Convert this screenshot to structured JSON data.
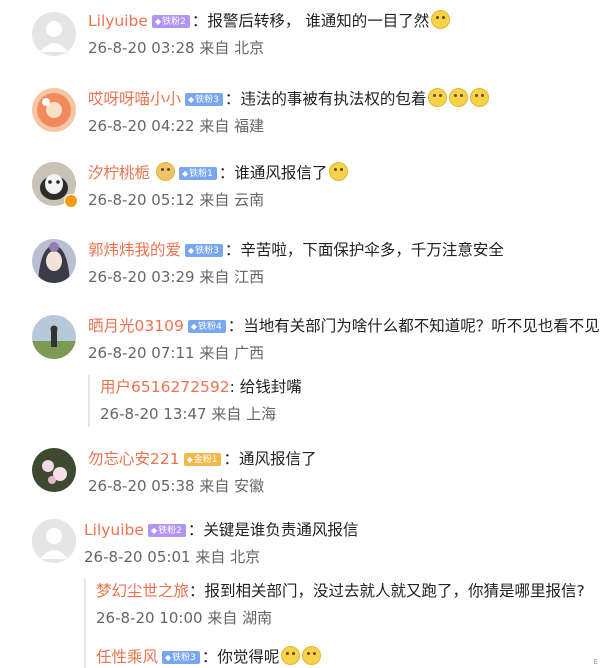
{
  "comments": [
    {
      "username": "Lilyuibe",
      "badge": "铁粉2",
      "badge_color": "purple",
      "text": "：报警后转移，  谁通知的一目了然",
      "emoji_count": 1,
      "date": "26-8-20 03:28",
      "from_label": "来自",
      "location": "北京"
    },
    {
      "username": "哎呀呀喵小小",
      "badge": "铁粉3",
      "badge_color": "blue",
      "text": "：违法的事被有执法权的包着",
      "emoji_count": 3,
      "date": "26-8-20 04:22",
      "from_label": "来自",
      "location": "福建"
    },
    {
      "username": "汐柠桃栀",
      "badge": "铁粉1",
      "badge_color": "blue",
      "text": "：谁通风报信了",
      "emoji_count": 1,
      "date": "26-8-20 05:12",
      "from_label": "来自",
      "location": "云南"
    },
    {
      "username": "郭炜炜我的爱",
      "badge": "铁粉3",
      "badge_color": "blue",
      "text": "：辛苦啦，下面保护伞多，千万注意安全",
      "emoji_count": 0,
      "date": "26-8-20 03:29",
      "from_label": "来自",
      "location": "江西"
    },
    {
      "username": "晒月光03109",
      "badge": "铁粉4",
      "badge_color": "blue",
      "text": "：当地有关部门为啥什么都不知道呢？听不见也看不见",
      "emoji_count": 0,
      "date": "26-8-20 07:11",
      "from_label": "来自",
      "location": "广西",
      "reply": {
        "username": "用户6516272592",
        "text": ": 给钱封嘴",
        "date": "26-8-20 13:47",
        "from_label": "来自",
        "location": "上海"
      }
    },
    {
      "username": "勿忘心安221",
      "badge": "金粉1",
      "badge_color": "gold",
      "text": "：通风报信了",
      "emoji_count": 0,
      "date": "26-8-20 05:38",
      "from_label": "来自",
      "location": "安徽"
    },
    {
      "username": "Lilyuibe",
      "badge": "铁粉2",
      "badge_color": "purple",
      "text": "：关键是谁负责通风报信",
      "emoji_count": 0,
      "date": "26-8-20 05:01",
      "from_label": "来自",
      "location": "北京",
      "reply": {
        "username": "梦幻尘世之旅",
        "text": "：报到相关部门，没过去就人就又跑了，你猜是哪里报信?",
        "date": "26-8-20 10:00",
        "from_label": "来自",
        "location": "湖南"
      },
      "reply2": {
        "username": "任性乘风",
        "badge": "铁粉3",
        "text": "：你觉得呢",
        "emoji_count": 2
      }
    }
  ],
  "corner_mark": "E"
}
